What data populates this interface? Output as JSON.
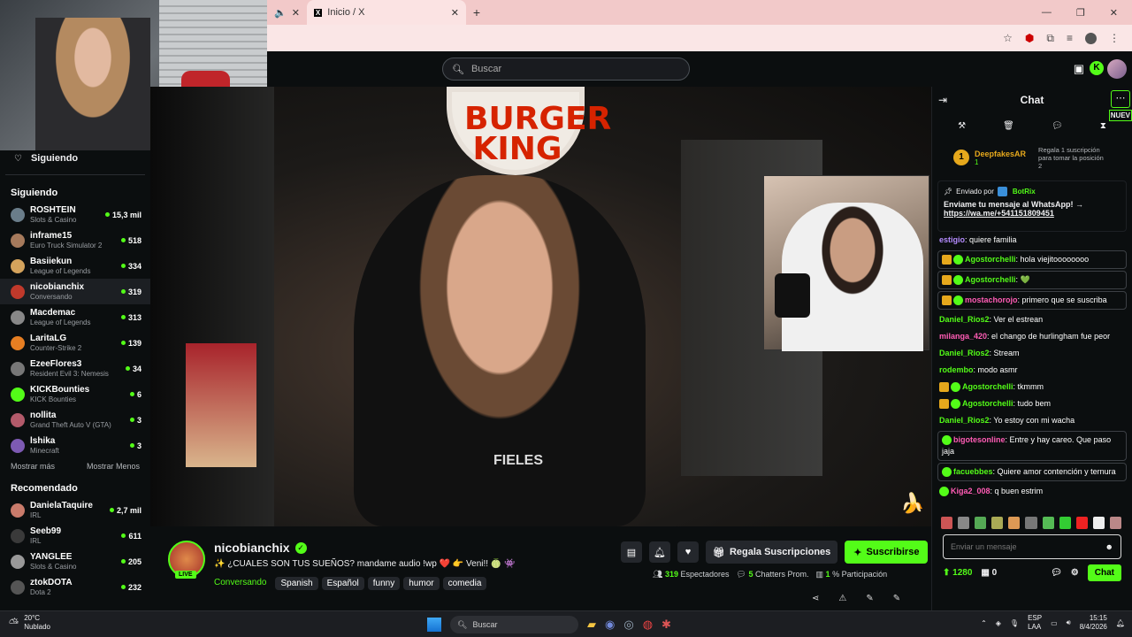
{
  "browser": {
    "tab1_label": "",
    "tab2_label": "Inicio / X",
    "new_tab": "+"
  },
  "header": {
    "search_placeholder": "Buscar"
  },
  "sidebar": {
    "top_label": "Siguiendo",
    "section_following": "Siguiendo",
    "following": [
      {
        "name": "ROSHTEIN",
        "game": "Slots & Casino",
        "count": "15,3 mil",
        "color": "#6a7d8a"
      },
      {
        "name": "inframe15",
        "game": "Euro Truck Simulator 2",
        "count": "518",
        "color": "#a67a5c"
      },
      {
        "name": "Basiiekun",
        "game": "League of Legends",
        "count": "334",
        "color": "#d4a35c"
      },
      {
        "name": "nicobianchix",
        "game": "Conversando",
        "count": "319",
        "color": "#c0392b"
      },
      {
        "name": "Macdemac",
        "game": "League of Legends",
        "count": "313",
        "color": "#888"
      },
      {
        "name": "LaritaLG",
        "game": "Counter-Strike 2",
        "count": "139",
        "color": "#e67e22"
      },
      {
        "name": "EzeeFlores3",
        "game": "Resident Evil 3: Nemesis",
        "count": "34",
        "color": "#777"
      },
      {
        "name": "KICKBounties",
        "game": "KICK Bounties",
        "count": "6",
        "color": "#53fc18"
      },
      {
        "name": "nollita",
        "game": "Grand Theft Auto V (GTA)",
        "count": "3",
        "color": "#b35a6a"
      },
      {
        "name": "lshika",
        "game": "Minecraft",
        "count": "3",
        "color": "#7d5ab3"
      }
    ],
    "show_more": "Mostrar más",
    "show_less": "Mostrar Menos",
    "section_recommended": "Recomendado",
    "recommended": [
      {
        "name": "DanielaTaquire",
        "game": "IRL",
        "count": "2,7 mil",
        "color": "#c97b6b"
      },
      {
        "name": "Seeb99",
        "game": "IRL",
        "count": "611",
        "color": "#3a3a3a"
      },
      {
        "name": "YANGLEE",
        "game": "Slots & Casino",
        "count": "205",
        "color": "#999"
      },
      {
        "name": "ztokDOTA",
        "game": "Dota 2",
        "count": "232",
        "color": "#555"
      }
    ]
  },
  "video": {
    "sign_text": "BURGER KING",
    "live_label": "LIVE"
  },
  "stream": {
    "channel": "nicobianchix",
    "title": "✨ ¿CUALES SON TUS SUEÑOS? mandame audio !wp ❤️ 👉 Veni!! 🍈 👾",
    "category": "Conversando",
    "tags": [
      "Spanish",
      "Español",
      "funny",
      "humor",
      "comedia"
    ],
    "gift_label": "Regala Suscripciones",
    "subscribe_label": "Suscribirse",
    "viewers": "319",
    "viewers_label": "Espectadores",
    "chatters": "5",
    "chatters_label": "Chatters Prom.",
    "participation": "1",
    "participation_label": "% Participación"
  },
  "chat": {
    "title": "Chat",
    "new_label": "NUEV",
    "top_gifter": {
      "rank": "1",
      "name": "DeepfakesAR",
      "count": "1",
      "note": "Regala 1 suscripción para tomar la posición 2"
    },
    "pinned": {
      "sent_by": "Enviado por",
      "bot": "BotRix",
      "text": "Enviame tu mensaje al WhatsApp! →",
      "link": "https://wa.me/+541151809451"
    },
    "messages": [
      {
        "user": "estigio",
        "text": "quiere familia",
        "color": "#b58cff",
        "badges": 0
      },
      {
        "user": "Agostorchelli",
        "text": "hola viejitoooooooo",
        "color": "#53fc18",
        "badges": 2
      },
      {
        "user": "Agostorchelli",
        "text": "💚",
        "color": "#53fc18",
        "badges": 2
      },
      {
        "user": "mostachorojo",
        "text": "primero que se suscriba",
        "color": "#ff5cb5",
        "badges": 2
      },
      {
        "user": "Daniel_Rios2",
        "text": "Ver el estrean",
        "color": "#53fc18",
        "badges": 0
      },
      {
        "user": "milanga_420",
        "text": "el chango de hurlingham fue peor",
        "color": "#ff5cb5",
        "badges": 0
      },
      {
        "user": "Daniel_Rios2",
        "text": "Stream",
        "color": "#53fc18",
        "badges": 0
      },
      {
        "user": "rodembo",
        "text": "modo asmr",
        "color": "#53fc18",
        "badges": 0
      },
      {
        "user": "Agostorchelli",
        "text": "tkmmm",
        "color": "#53fc18",
        "badges": 2
      },
      {
        "user": "Agostorchelli",
        "text": "tudo bem",
        "color": "#53fc18",
        "badges": 2
      },
      {
        "user": "Daniel_Rios2",
        "text": "Yo estoy con mi wacha",
        "color": "#53fc18",
        "badges": 0
      },
      {
        "user": "bigotesonline",
        "text": "Entre y hay careo. Que paso jaja",
        "color": "#ff5cb5",
        "badges": 1
      },
      {
        "user": "facuebbes",
        "text": "Quiere amor contención y ternura",
        "color": "#53fc18",
        "badges": 1
      },
      {
        "user": "Kiga2_008",
        "text": "q buen estrim",
        "color": "#ff5cb5",
        "badges": 1
      }
    ],
    "input_placeholder": "Enviar un mensaje",
    "points": "1280",
    "other_points": "0",
    "send_label": "Chat"
  },
  "taskbar": {
    "weather_temp": "20°C",
    "weather_desc": "Nublado",
    "search": "Buscar",
    "lang": "ESP",
    "lang2": "LAA",
    "time": "15:15",
    "date": "8/4/2026"
  },
  "colors": {
    "accent": "#53fc18",
    "bg": "#0b0e0f"
  }
}
